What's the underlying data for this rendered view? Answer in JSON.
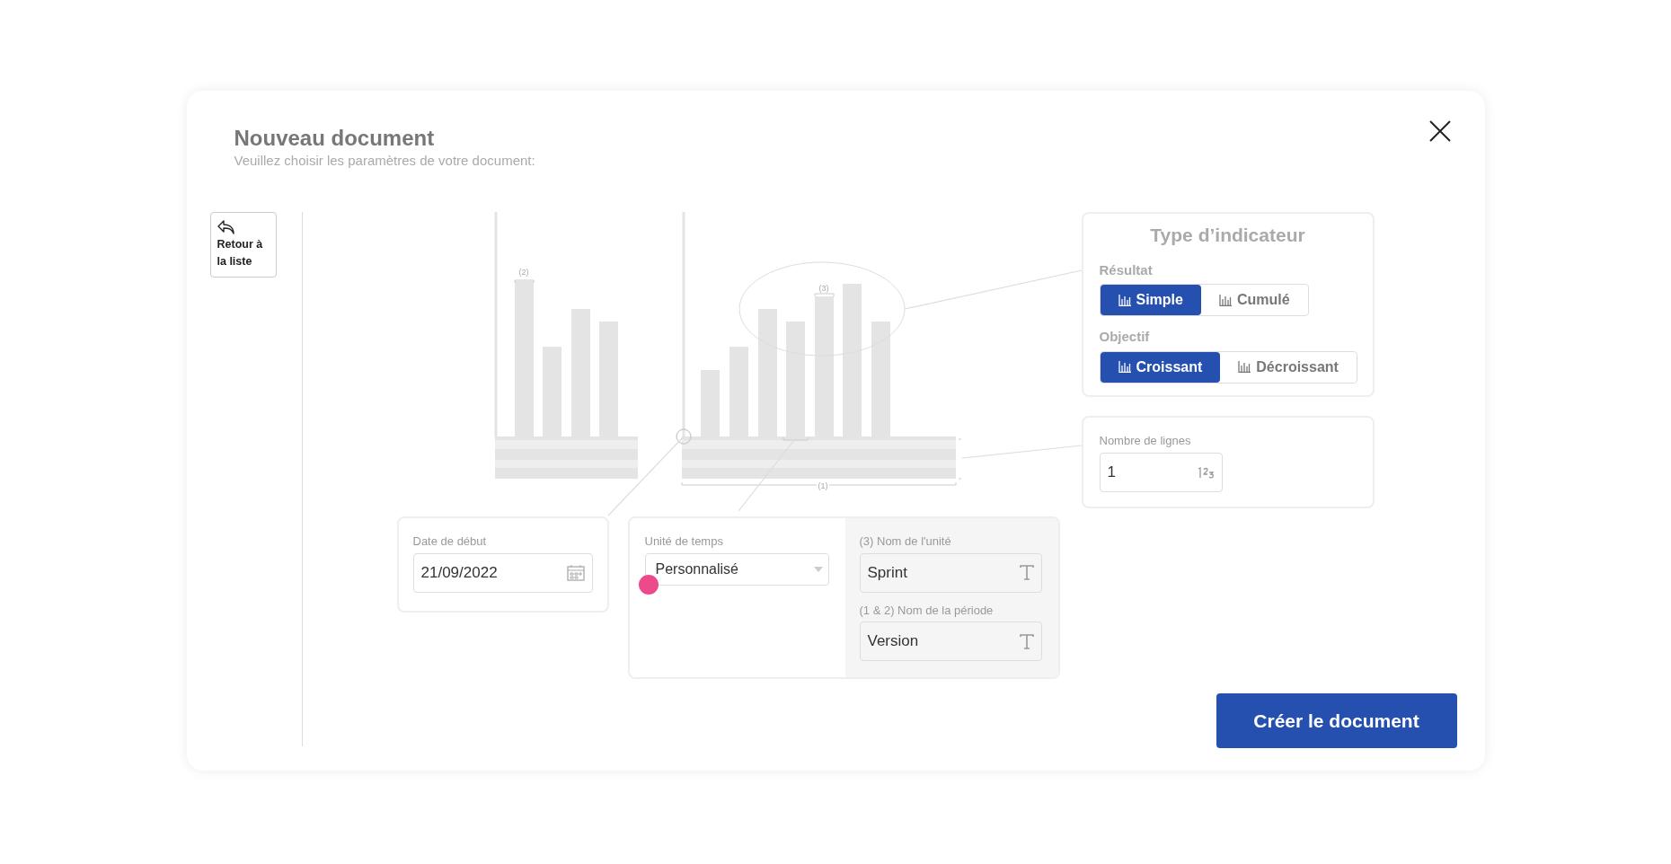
{
  "dialog": {
    "title": "Nouveau document",
    "subtitle": "Veuillez choisir les paramètres de votre document:"
  },
  "back_button": {
    "label": "Retour à la liste"
  },
  "illustration": {
    "labels": [
      "(2)",
      "(3)",
      "(1)"
    ]
  },
  "indicator_type": {
    "title": "Type d’indicateur",
    "groups": [
      {
        "label": "Résultat",
        "options": [
          {
            "label": "Simple",
            "selected": true
          },
          {
            "label": "Cumulé",
            "selected": false
          }
        ]
      },
      {
        "label": "Objectif",
        "options": [
          {
            "label": "Croissant",
            "selected": true
          },
          {
            "label": "Décroissant",
            "selected": false
          }
        ]
      }
    ]
  },
  "line_count": {
    "label": "Nombre de lignes",
    "value": "1"
  },
  "start_date": {
    "label": "Date de début",
    "value": "21/09/2022"
  },
  "time_unit": {
    "label": "Unité de temps",
    "value": "Personnalisé"
  },
  "unit_name": {
    "label": "(3) Nom de l'unité",
    "value": "Sprint"
  },
  "period_name": {
    "label": "(1 & 2) Nom de la période",
    "value": "Version"
  },
  "create_button": {
    "label": "Créer le document"
  }
}
